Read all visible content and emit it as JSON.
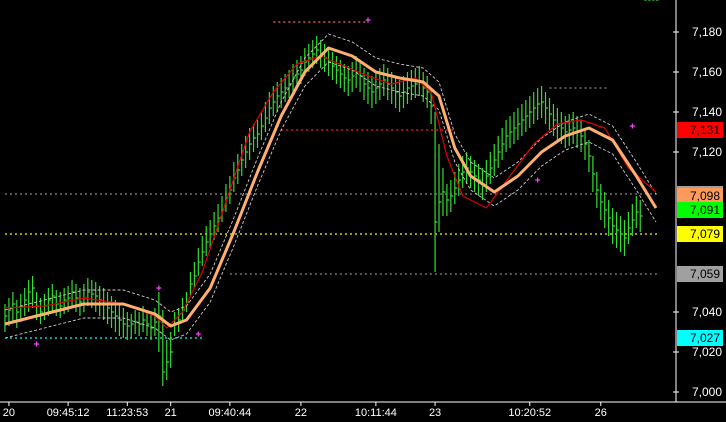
{
  "chart_data": {
    "type": "line",
    "title": "",
    "xlabel": "",
    "ylabel": "",
    "ylim": [
      6996,
      7192
    ],
    "grid": false,
    "legend": "none",
    "y_ticks": [
      {
        "value": 7180,
        "label": "7,180"
      },
      {
        "value": 7160,
        "label": "7,160"
      },
      {
        "value": 7140,
        "label": "7,140"
      },
      {
        "value": 7120,
        "label": "7,120"
      },
      {
        "value": 7040,
        "label": "7,040"
      },
      {
        "value": 7020,
        "label": "7,020"
      },
      {
        "value": 7000,
        "label": "7,000"
      }
    ],
    "x_ticks": [
      {
        "index": 1,
        "label": "20"
      },
      {
        "index": 16,
        "label": "09:45:12"
      },
      {
        "index": 31,
        "label": "11:23:53"
      },
      {
        "index": 42,
        "label": "21"
      },
      {
        "index": 57,
        "label": "09:40:44"
      },
      {
        "index": 75,
        "label": "22"
      },
      {
        "index": 94,
        "label": "10:11:44"
      },
      {
        "index": 109,
        "label": "23"
      },
      {
        "index": 133,
        "label": "10:20:52"
      },
      {
        "index": 151,
        "label": "26"
      }
    ],
    "price_badges": [
      {
        "value": 7131,
        "label": "7,131",
        "bg": "#ff0000",
        "fg": "#000000"
      },
      {
        "value": 7099,
        "label": "7,099",
        "bg": "#a0a0a0",
        "fg": "#000000"
      },
      {
        "value": 7098,
        "label": "7,098",
        "bg": "#ff9a5c",
        "fg": "#000000"
      },
      {
        "value": 7091,
        "label": "7,091",
        "bg": "#00ff00",
        "fg": "#000000"
      },
      {
        "value": 7079,
        "label": "7,079",
        "bg": "#ffff00",
        "fg": "#000000"
      },
      {
        "value": 7059,
        "label": "7,059",
        "bg": "#a0a0a0",
        "fg": "#000000"
      },
      {
        "value": 7027,
        "label": "7,027",
        "bg": "#00ffff",
        "fg": "#000000"
      }
    ],
    "horizontal_lines": [
      {
        "value": 7185,
        "color": "#ff6666",
        "from": 68,
        "to": 92,
        "style": "dotted"
      },
      {
        "value": 7131,
        "color": "#ff2222",
        "from": 70,
        "to": 114,
        "style": "dotted"
      },
      {
        "value": 7152,
        "color": "#888888",
        "from": 138,
        "to": 153,
        "style": "dotted"
      },
      {
        "value": 7099,
        "color": "#888888",
        "from": 0,
        "to": 166,
        "style": "dotted"
      },
      {
        "value": 7079,
        "color": "#ffff00",
        "from": 0,
        "to": 166,
        "style": "dotted"
      },
      {
        "value": 7059,
        "color": "#888888",
        "from": 57,
        "to": 166,
        "style": "dotted"
      },
      {
        "value": 7027,
        "color": "#00ffff",
        "from": 0,
        "to": 50,
        "style": "dotted"
      }
    ],
    "markers": [
      {
        "index": 8,
        "value": 7024,
        "color": "#ff44ff"
      },
      {
        "index": 39,
        "value": 7052,
        "color": "#ff44ff"
      },
      {
        "index": 49,
        "value": 7029,
        "color": "#ff44ff"
      },
      {
        "index": 92,
        "value": 7186,
        "color": "#ff44ff"
      },
      {
        "index": 135,
        "value": 7106,
        "color": "#ff44ff"
      },
      {
        "index": 159,
        "value": 7133,
        "color": "#ff44ff"
      }
    ],
    "colors": {
      "background": "#000000",
      "price_bars": "#33dd33",
      "ema_fast": "#dd0000",
      "ema_slow": "#ffb070",
      "band": "#cccccc",
      "axis_text": "#ffffff"
    },
    "series": [
      {
        "kind": "ohlc",
        "x": [
          0,
          1,
          2,
          3,
          4,
          5,
          6,
          7,
          8,
          9,
          10,
          11,
          12,
          13,
          14,
          15,
          16,
          17,
          18,
          19,
          20,
          21,
          22,
          23,
          24,
          25,
          26,
          27,
          28,
          29,
          30,
          31,
          32,
          33,
          34,
          35,
          36,
          37,
          38,
          39,
          40,
          41,
          42,
          43,
          44,
          45,
          46,
          47,
          48,
          49,
          50,
          51,
          52,
          53,
          54,
          55,
          56,
          57,
          58,
          59,
          60,
          61,
          62,
          63,
          64,
          65,
          66,
          67,
          68,
          69,
          70,
          71,
          72,
          73,
          74,
          75,
          76,
          77,
          78,
          79,
          80,
          81,
          82,
          83,
          84,
          85,
          86,
          87,
          88,
          89,
          90,
          91,
          92,
          93,
          94,
          95,
          96,
          97,
          98,
          99,
          100,
          101,
          102,
          103,
          104,
          105,
          106,
          107,
          108,
          109,
          110,
          111,
          112,
          113,
          114,
          115,
          116,
          117,
          118,
          119,
          120,
          121,
          122,
          123,
          124,
          125,
          126,
          127,
          128,
          129,
          130,
          131,
          132,
          133,
          134,
          135,
          136,
          137,
          138,
          139,
          140,
          141,
          142,
          143,
          144,
          145,
          146,
          147,
          148,
          149,
          150,
          151,
          152,
          153,
          154,
          155,
          156,
          157,
          158,
          159,
          160,
          161,
          162,
          163,
          164,
          165
        ],
        "high": [
          7044,
          7047,
          7050,
          7046,
          7049,
          7052,
          7056,
          7058,
          7050,
          7047,
          7049,
          7052,
          7054,
          7051,
          7050,
          7052,
          7053,
          7056,
          7054,
          7052,
          7054,
          7057,
          7056,
          7055,
          7053,
          7052,
          7050,
          7048,
          7046,
          7044,
          7042,
          7040,
          7039,
          7041,
          7040,
          7043,
          7041,
          7039,
          7042,
          7050,
          7041,
          7026,
          7030,
          7040,
          7042,
          7047,
          7050,
          7060,
          7065,
          7072,
          7078,
          7083,
          7086,
          7090,
          7094,
          7098,
          7104,
          7108,
          7115,
          7119,
          7124,
          7128,
          7132,
          7134,
          7136,
          7140,
          7145,
          7150,
          7153,
          7155,
          7157,
          7159,
          7161,
          7164,
          7166,
          7168,
          7172,
          7174,
          7176,
          7178,
          7176,
          7174,
          7172,
          7170,
          7168,
          7166,
          7164,
          7163,
          7165,
          7168,
          7166,
          7162,
          7160,
          7158,
          7160,
          7162,
          7164,
          7162,
          7160,
          7158,
          7156,
          7158,
          7160,
          7161,
          7162,
          7163,
          7160,
          7158,
          7152,
          7140,
          7124,
          7112,
          7104,
          7106,
          7110,
          7114,
          7118,
          7120,
          7118,
          7116,
          7114,
          7112,
          7116,
          7120,
          7124,
          7128,
          7132,
          7136,
          7138,
          7140,
          7142,
          7144,
          7146,
          7148,
          7150,
          7152,
          7153,
          7150,
          7147,
          7144,
          7142,
          7140,
          7138,
          7139,
          7140,
          7138,
          7136,
          7132,
          7126,
          7118,
          7110,
          7104,
          7100,
          7096,
          7092,
          7090,
          7088,
          7086,
          7090,
          7094,
          7098,
          7096
        ],
        "low": [
          7030,
          7033,
          7035,
          7032,
          7035,
          7038,
          7040,
          7042,
          7036,
          7034,
          7036,
          7038,
          7040,
          7038,
          7037,
          7039,
          7040,
          7042,
          7040,
          7038,
          7040,
          7043,
          7042,
          7040,
          7038,
          7036,
          7034,
          7032,
          7030,
          7028,
          7027,
          7026,
          7027,
          7029,
          7028,
          7030,
          7028,
          7026,
          7028,
          7020,
          7003,
          7006,
          7012,
          7028,
          7030,
          7035,
          7040,
          7048,
          7052,
          7058,
          7063,
          7068,
          7072,
          7076,
          7080,
          7085,
          7090,
          7094,
          7100,
          7104,
          7108,
          7112,
          7116,
          7120,
          7122,
          7126,
          7130,
          7134,
          7138,
          7140,
          7142,
          7145,
          7147,
          7150,
          7152,
          7154,
          7158,
          7160,
          7162,
          7164,
          7162,
          7160,
          7158,
          7156,
          7154,
          7152,
          7150,
          7148,
          7150,
          7152,
          7150,
          7146,
          7144,
          7142,
          7144,
          7146,
          7148,
          7146,
          7144,
          7142,
          7140,
          7142,
          7144,
          7146,
          7147,
          7148,
          7145,
          7142,
          7134,
          7060,
          7080,
          7088,
          7088,
          7090,
          7094,
          7098,
          7102,
          7104,
          7102,
          7100,
          7098,
          7096,
          7100,
          7104,
          7108,
          7112,
          7116,
          7120,
          7122,
          7124,
          7126,
          7128,
          7130,
          7132,
          7134,
          7136,
          7137,
          7134,
          7131,
          7128,
          7126,
          7124,
          7122,
          7123,
          7124,
          7122,
          7120,
          7116,
          7110,
          7100,
          7092,
          7086,
          7082,
          7078,
          7074,
          7072,
          7070,
          7068,
          7074,
          7078,
          7082,
          7080
        ],
        "close": [
          7038,
          7041,
          7044,
          7040,
          7043,
          7046,
          7050,
          7052,
          7043,
          7040,
          7043,
          7046,
          7048,
          7044,
          7043,
          7046,
          7047,
          7050,
          7047,
          7045,
          7047,
          7050,
          7049,
          7048,
          7046,
          7044,
          7042,
          7040,
          7038,
          7036,
          7034,
          7033,
          7034,
          7035,
          7034,
          7036,
          7034,
          7032,
          7035,
          7038,
          7010,
          7015,
          7020,
          7034,
          7036,
          7041,
          7045,
          7054,
          7058,
          7065,
          7070,
          7075,
          7079,
          7083,
          7087,
          7091,
          7097,
          7101,
          7107,
          7111,
          7116,
          7120,
          7124,
          7127,
          7129,
          7133,
          7137,
          7142,
          7145,
          7148,
          7150,
          7152,
          7154,
          7157,
          7159,
          7161,
          7165,
          7167,
          7169,
          7171,
          7169,
          7167,
          7165,
          7163,
          7161,
          7159,
          7157,
          7156,
          7158,
          7160,
          7158,
          7154,
          7152,
          7150,
          7152,
          7154,
          7156,
          7154,
          7152,
          7150,
          7148,
          7150,
          7152,
          7153,
          7154,
          7155,
          7152,
          7150,
          7143,
          7085,
          7095,
          7100,
          7096,
          7098,
          7102,
          7106,
          7110,
          7112,
          7110,
          7108,
          7106,
          7104,
          7108,
          7112,
          7116,
          7120,
          7124,
          7128,
          7130,
          7132,
          7134,
          7136,
          7138,
          7140,
          7142,
          7144,
          7145,
          7142,
          7139,
          7136,
          7134,
          7132,
          7130,
          7131,
          7132,
          7130,
          7128,
          7124,
          7118,
          7109,
          7101,
          7095,
          7091,
          7087,
          7083,
          7081,
          7079,
          7077,
          7082,
          7086,
          7090,
          7088
        ]
      },
      {
        "name": "",
        "kind": "ema-fast",
        "x": [
          0,
          10,
          20,
          30,
          38,
          41,
          45,
          50,
          56,
          62,
          68,
          74,
          80,
          86,
          92,
          98,
          104,
          108,
          112,
          116,
          122,
          128,
          134,
          140,
          146,
          152,
          158,
          165
        ],
        "values": [
          7042,
          7043,
          7047,
          7044,
          7038,
          7032,
          7040,
          7060,
          7095,
          7130,
          7150,
          7164,
          7168,
          7163,
          7158,
          7154,
          7157,
          7150,
          7118,
          7098,
          7092,
          7108,
          7124,
          7134,
          7136,
          7132,
          7112,
          7100
        ]
      },
      {
        "name": "",
        "kind": "ema-slow",
        "x": [
          0,
          10,
          20,
          30,
          38,
          42,
          46,
          52,
          58,
          64,
          70,
          76,
          82,
          88,
          94,
          100,
          106,
          110,
          114,
          118,
          124,
          130,
          136,
          142,
          148,
          154,
          160,
          165
        ],
        "values": [
          7034,
          7039,
          7044,
          7044,
          7039,
          7033,
          7036,
          7052,
          7080,
          7110,
          7138,
          7160,
          7172,
          7168,
          7160,
          7157,
          7155,
          7148,
          7122,
          7108,
          7100,
          7108,
          7120,
          7128,
          7132,
          7126,
          7108,
          7092
        ]
      },
      {
        "name": "",
        "kind": "band-upper",
        "x": [
          0,
          10,
          20,
          30,
          38,
          42,
          46,
          52,
          58,
          64,
          70,
          76,
          82,
          88,
          94,
          100,
          106,
          110,
          114,
          118,
          124,
          130,
          136,
          142,
          148,
          154,
          160,
          165
        ],
        "values": [
          7041,
          7046,
          7051,
          7051,
          7046,
          7040,
          7043,
          7059,
          7087,
          7117,
          7145,
          7167,
          7179,
          7175,
          7167,
          7164,
          7162,
          7155,
          7129,
          7115,
          7107,
          7115,
          7127,
          7135,
          7139,
          7133,
          7115,
          7099
        ]
      },
      {
        "name": "",
        "kind": "band-lower",
        "x": [
          0,
          10,
          20,
          30,
          38,
          42,
          46,
          52,
          58,
          64,
          70,
          76,
          82,
          88,
          94,
          100,
          106,
          110,
          114,
          118,
          124,
          130,
          136,
          142,
          148,
          154,
          160,
          165
        ],
        "values": [
          7027,
          7032,
          7037,
          7037,
          7032,
          7026,
          7029,
          7045,
          7073,
          7103,
          7131,
          7153,
          7165,
          7161,
          7153,
          7150,
          7148,
          7141,
          7115,
          7101,
          7093,
          7101,
          7113,
          7121,
          7125,
          7119,
          7101,
          7085
        ]
      }
    ]
  }
}
